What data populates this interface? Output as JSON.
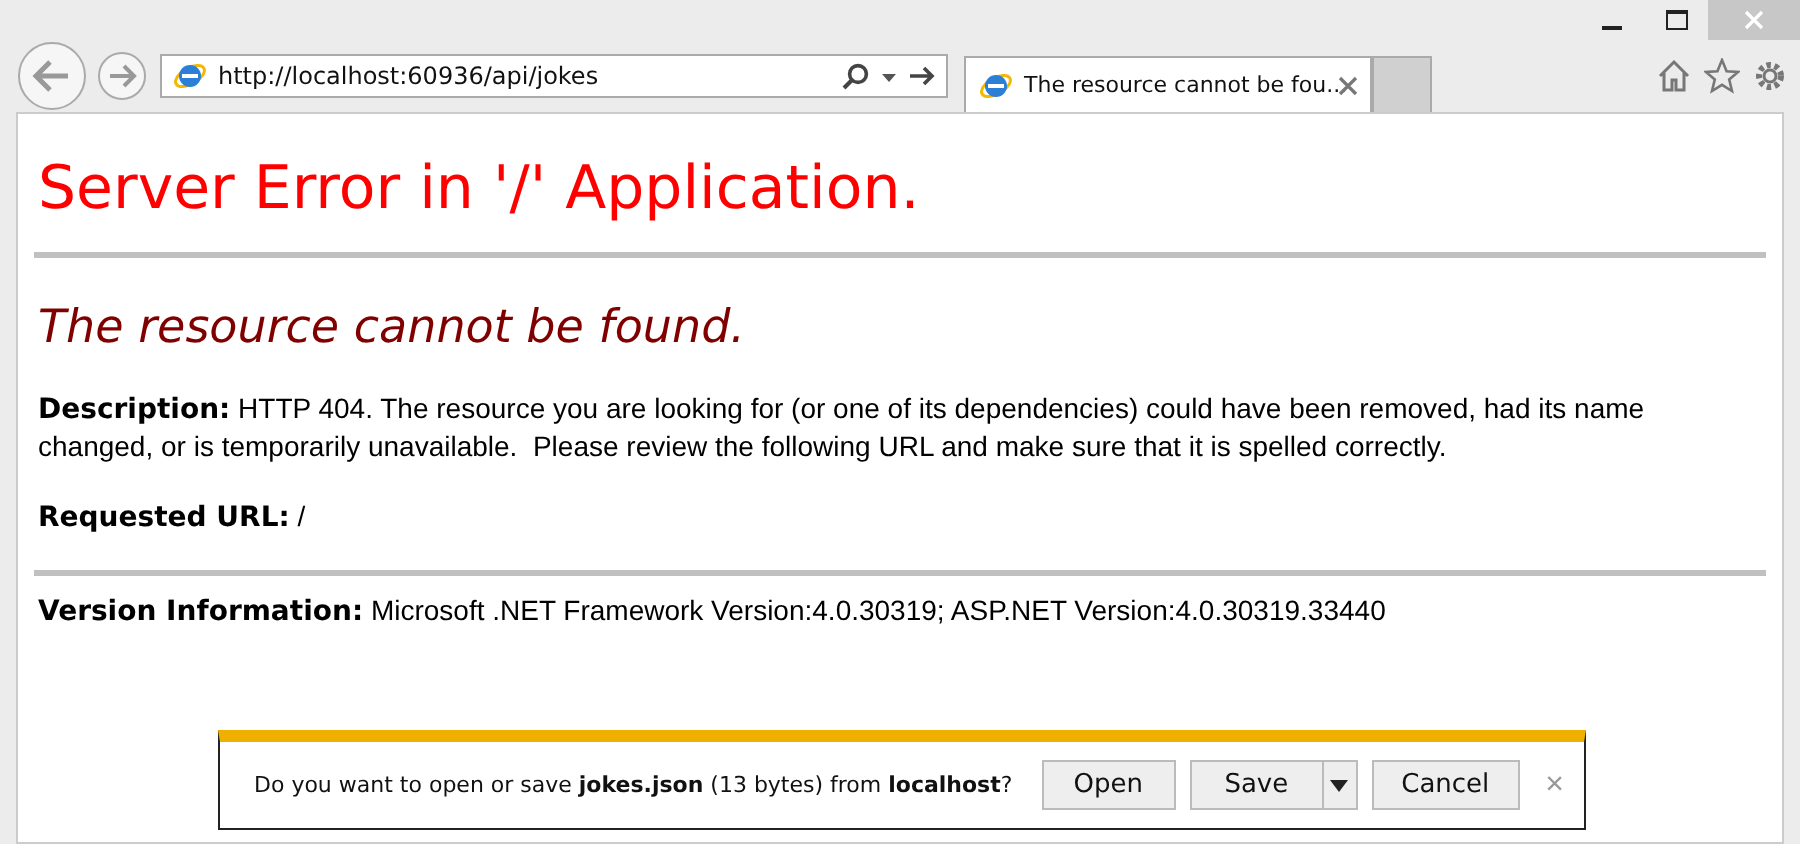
{
  "browser": {
    "address": "http://localhost:60936/api/jokes",
    "tab": {
      "title": "The resource cannot be fou...",
      "selected": true
    }
  },
  "page": {
    "title": "Server Error in '/' Application.",
    "subtitle": "The resource cannot be found.",
    "paragraphs": [
      "**Description:** HTTP 404. The resource you are looking for (or one of its dependencies) could have been removed, had its name changed, or is temporarily unavailable.  Please review the following URL and make sure that it is spelled correctly.",
      "**Requested URL:** /"
    ],
    "version": "**Version Information:** Microsoft .NET Framework Version:4.0.30319; ASP.NET Version:4.0.30319.33440"
  },
  "download_bar": {
    "message": "Do you want to open or save **jokes.json** (13 bytes) from **localhost**?",
    "buttons": [
      "Open",
      "Save",
      "Cancel"
    ],
    "close": "×"
  }
}
